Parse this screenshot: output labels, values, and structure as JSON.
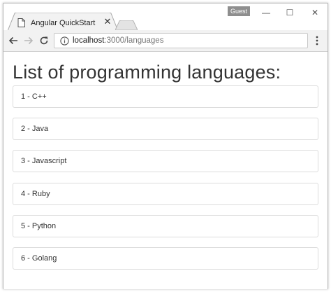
{
  "browser": {
    "tab_title": "Angular QuickStart",
    "guest_label": "Guest",
    "url_host": "localhost",
    "url_path": ":3000/languages",
    "icons": {
      "page": "page-icon",
      "close": "close-icon",
      "back": "back-arrow-icon",
      "forward": "forward-arrow-icon",
      "reload": "reload-icon",
      "info": "info-icon",
      "menu": "kebab-menu-icon",
      "minimize": "minimize-icon",
      "maximize": "maximize-icon",
      "window_close": "window-close-icon"
    }
  },
  "page": {
    "title": "List of programming languages:",
    "languages": [
      {
        "label": "1 - C++"
      },
      {
        "label": "2 - Java"
      },
      {
        "label": "3 - Javascript"
      },
      {
        "label": "4 - Ruby"
      },
      {
        "label": "5 - Python"
      },
      {
        "label": "6 - Golang"
      }
    ]
  }
}
